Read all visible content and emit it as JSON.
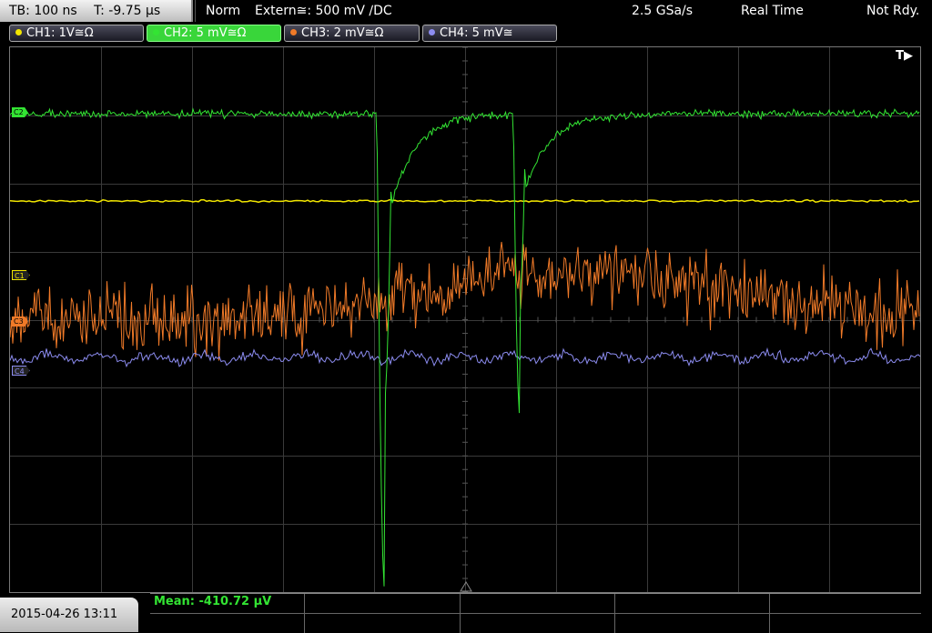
{
  "status": {
    "timebase": "TB: 100 ns",
    "trigger_time": "T: -9.75 µs",
    "mode": "Norm",
    "trigger": "Extern≅: 500 mV ∕DC",
    "sample_rate": "2.5 GSa/s",
    "acq_mode": "Real Time",
    "state": "Not Rdy."
  },
  "channels": [
    {
      "label": "CH1: 1V≅Ω",
      "color": "#f2e600",
      "active": false
    },
    {
      "label": "CH2: 5 mV≅Ω",
      "color": "#33e433",
      "active": true
    },
    {
      "label": "CH3: 2 mV≅Ω",
      "color": "#f07a28",
      "active": false
    },
    {
      "label": "CH4: 5 mV≅",
      "color": "#8c8cf0",
      "active": false
    }
  ],
  "markers": {
    "c1": "C1",
    "c2": "C2",
    "c3": "C3",
    "c4": "C4",
    "trigger": "T▶"
  },
  "measurement": {
    "mean": "Mean: -410.72 µV"
  },
  "datetime": "2015-04-26 13:11"
}
